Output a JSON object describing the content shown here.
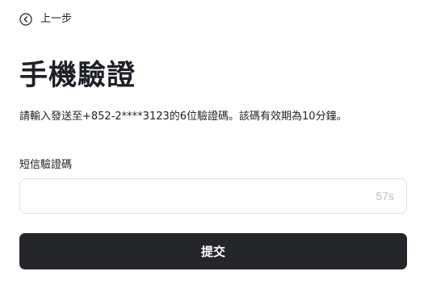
{
  "header": {
    "back_label": "上一步",
    "back_icon": "chevron-left-circle-icon"
  },
  "main": {
    "title": "手機驗證",
    "instruction": "請輸入發送至+852-2****3123的6位驗證碼。該碼有效期為10分鐘。",
    "sms_code_field": {
      "label": "短信驗證碼",
      "value": "",
      "placeholder": "",
      "countdown": "57s"
    },
    "submit_label": "提交"
  },
  "colors": {
    "text": "#1e2026",
    "button_bg": "#25262a",
    "button_text": "#ffffff",
    "input_border": "#dcdfe4",
    "countdown_text": "#b7bdc6"
  }
}
